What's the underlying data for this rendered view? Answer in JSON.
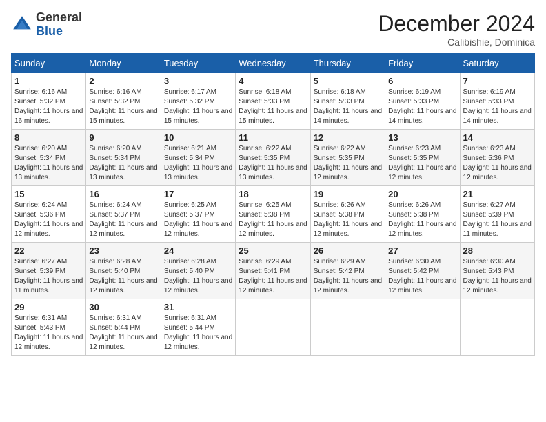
{
  "header": {
    "logo_general": "General",
    "logo_blue": "Blue",
    "title": "December 2024",
    "subtitle": "Calibishie, Dominica"
  },
  "weekdays": [
    "Sunday",
    "Monday",
    "Tuesday",
    "Wednesday",
    "Thursday",
    "Friday",
    "Saturday"
  ],
  "weeks": [
    [
      {
        "day": "1",
        "sunrise": "6:16 AM",
        "sunset": "5:32 PM",
        "daylight": "11 hours and 16 minutes."
      },
      {
        "day": "2",
        "sunrise": "6:16 AM",
        "sunset": "5:32 PM",
        "daylight": "11 hours and 15 minutes."
      },
      {
        "day": "3",
        "sunrise": "6:17 AM",
        "sunset": "5:32 PM",
        "daylight": "11 hours and 15 minutes."
      },
      {
        "day": "4",
        "sunrise": "6:18 AM",
        "sunset": "5:33 PM",
        "daylight": "11 hours and 15 minutes."
      },
      {
        "day": "5",
        "sunrise": "6:18 AM",
        "sunset": "5:33 PM",
        "daylight": "11 hours and 14 minutes."
      },
      {
        "day": "6",
        "sunrise": "6:19 AM",
        "sunset": "5:33 PM",
        "daylight": "11 hours and 14 minutes."
      },
      {
        "day": "7",
        "sunrise": "6:19 AM",
        "sunset": "5:33 PM",
        "daylight": "11 hours and 14 minutes."
      }
    ],
    [
      {
        "day": "8",
        "sunrise": "6:20 AM",
        "sunset": "5:34 PM",
        "daylight": "11 hours and 13 minutes."
      },
      {
        "day": "9",
        "sunrise": "6:20 AM",
        "sunset": "5:34 PM",
        "daylight": "11 hours and 13 minutes."
      },
      {
        "day": "10",
        "sunrise": "6:21 AM",
        "sunset": "5:34 PM",
        "daylight": "11 hours and 13 minutes."
      },
      {
        "day": "11",
        "sunrise": "6:22 AM",
        "sunset": "5:35 PM",
        "daylight": "11 hours and 13 minutes."
      },
      {
        "day": "12",
        "sunrise": "6:22 AM",
        "sunset": "5:35 PM",
        "daylight": "11 hours and 12 minutes."
      },
      {
        "day": "13",
        "sunrise": "6:23 AM",
        "sunset": "5:35 PM",
        "daylight": "11 hours and 12 minutes."
      },
      {
        "day": "14",
        "sunrise": "6:23 AM",
        "sunset": "5:36 PM",
        "daylight": "11 hours and 12 minutes."
      }
    ],
    [
      {
        "day": "15",
        "sunrise": "6:24 AM",
        "sunset": "5:36 PM",
        "daylight": "11 hours and 12 minutes."
      },
      {
        "day": "16",
        "sunrise": "6:24 AM",
        "sunset": "5:37 PM",
        "daylight": "11 hours and 12 minutes."
      },
      {
        "day": "17",
        "sunrise": "6:25 AM",
        "sunset": "5:37 PM",
        "daylight": "11 hours and 12 minutes."
      },
      {
        "day": "18",
        "sunrise": "6:25 AM",
        "sunset": "5:38 PM",
        "daylight": "11 hours and 12 minutes."
      },
      {
        "day": "19",
        "sunrise": "6:26 AM",
        "sunset": "5:38 PM",
        "daylight": "11 hours and 12 minutes."
      },
      {
        "day": "20",
        "sunrise": "6:26 AM",
        "sunset": "5:38 PM",
        "daylight": "11 hours and 12 minutes."
      },
      {
        "day": "21",
        "sunrise": "6:27 AM",
        "sunset": "5:39 PM",
        "daylight": "11 hours and 11 minutes."
      }
    ],
    [
      {
        "day": "22",
        "sunrise": "6:27 AM",
        "sunset": "5:39 PM",
        "daylight": "11 hours and 11 minutes."
      },
      {
        "day": "23",
        "sunrise": "6:28 AM",
        "sunset": "5:40 PM",
        "daylight": "11 hours and 12 minutes."
      },
      {
        "day": "24",
        "sunrise": "6:28 AM",
        "sunset": "5:40 PM",
        "daylight": "11 hours and 12 minutes."
      },
      {
        "day": "25",
        "sunrise": "6:29 AM",
        "sunset": "5:41 PM",
        "daylight": "11 hours and 12 minutes."
      },
      {
        "day": "26",
        "sunrise": "6:29 AM",
        "sunset": "5:42 PM",
        "daylight": "11 hours and 12 minutes."
      },
      {
        "day": "27",
        "sunrise": "6:30 AM",
        "sunset": "5:42 PM",
        "daylight": "11 hours and 12 minutes."
      },
      {
        "day": "28",
        "sunrise": "6:30 AM",
        "sunset": "5:43 PM",
        "daylight": "11 hours and 12 minutes."
      }
    ],
    [
      {
        "day": "29",
        "sunrise": "6:31 AM",
        "sunset": "5:43 PM",
        "daylight": "11 hours and 12 minutes."
      },
      {
        "day": "30",
        "sunrise": "6:31 AM",
        "sunset": "5:44 PM",
        "daylight": "11 hours and 12 minutes."
      },
      {
        "day": "31",
        "sunrise": "6:31 AM",
        "sunset": "5:44 PM",
        "daylight": "11 hours and 12 minutes."
      },
      null,
      null,
      null,
      null
    ]
  ]
}
